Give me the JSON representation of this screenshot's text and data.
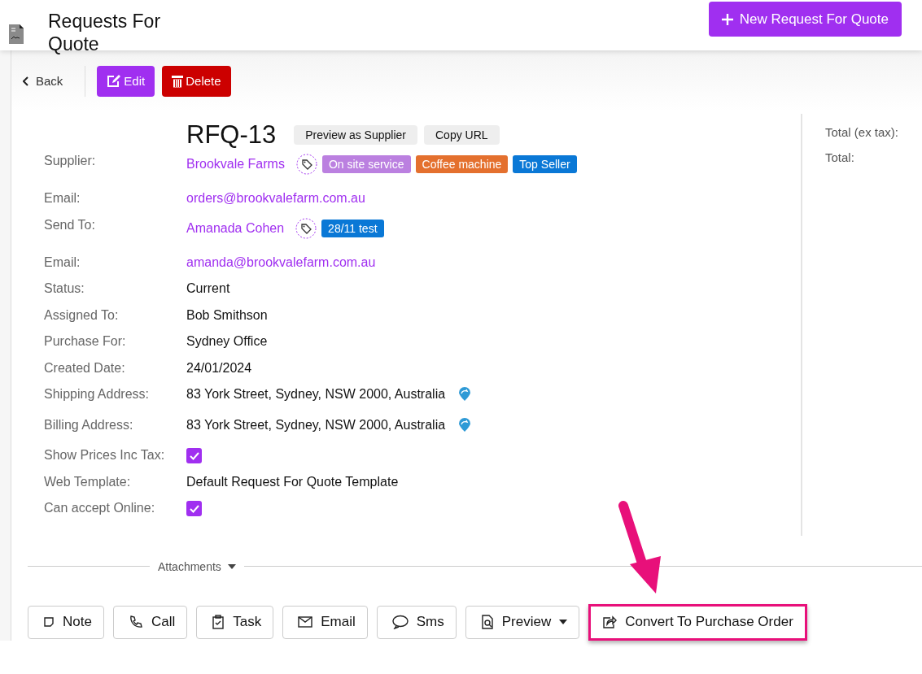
{
  "header": {
    "title": "Requests For Quote",
    "new_button": "New Request For Quote"
  },
  "toolbar": {
    "back": "Back",
    "edit": "Edit",
    "delete": "Delete"
  },
  "record": {
    "title": "RFQ-13",
    "actions": [
      "Preview as Supplier",
      "Copy URL"
    ]
  },
  "fields": [
    {
      "label": "Supplier:",
      "kind": "link",
      "value": "Brookvale Farms",
      "tags": [
        {
          "text": "On site service",
          "color": "#bb80e0"
        },
        {
          "text": "Coffee machine",
          "color": "#e4702e"
        },
        {
          "text": "Top Seller",
          "color": "#0a78d6"
        }
      ]
    },
    {
      "label": "Email:",
      "kind": "link",
      "value": "orders@brookvalefarm.com.au"
    },
    {
      "label": "Send To:",
      "kind": "link",
      "value": "Amanada Cohen",
      "tags": [
        {
          "text": "28/11 test",
          "color": "#0a78d6"
        }
      ]
    },
    {
      "label": "Email:",
      "kind": "link",
      "value": "amanda@brookvalefarm.com.au"
    },
    {
      "label": "Status:",
      "kind": "text",
      "value": "Current"
    },
    {
      "label": "Assigned To:",
      "kind": "text",
      "value": "Bob Smithson"
    },
    {
      "label": "Purchase For:",
      "kind": "text",
      "value": "Sydney Office"
    },
    {
      "label": "Created Date:",
      "kind": "text",
      "value": "24/01/2024"
    },
    {
      "label": "Shipping Address:",
      "kind": "address",
      "value": "83 York Street, Sydney, NSW 2000, Australia"
    },
    {
      "label": "Billing Address:",
      "kind": "address",
      "value": "83 York Street, Sydney, NSW 2000, Australia"
    },
    {
      "label": "Show Prices Inc Tax:",
      "kind": "checkbox",
      "checked": true
    },
    {
      "label": "Web Template:",
      "kind": "text",
      "value": "Default Request For Quote Template"
    },
    {
      "label": "Can accept Online:",
      "kind": "checkbox",
      "checked": true
    }
  ],
  "totals": [
    "Total (ex tax):",
    "Total:"
  ],
  "attachments": "Attachments",
  "actions": [
    {
      "kind": "note",
      "label": "Note",
      "highlighted": false
    },
    {
      "kind": "call",
      "label": "Call",
      "highlighted": false
    },
    {
      "kind": "task",
      "label": "Task",
      "highlighted": false
    },
    {
      "kind": "email",
      "label": "Email",
      "highlighted": false
    },
    {
      "kind": "sms",
      "label": "Sms",
      "highlighted": false
    },
    {
      "kind": "preview",
      "label": "Preview",
      "highlighted": false
    },
    {
      "kind": "convert",
      "label": "Convert To Purchase Order",
      "highlighted": true
    }
  ]
}
